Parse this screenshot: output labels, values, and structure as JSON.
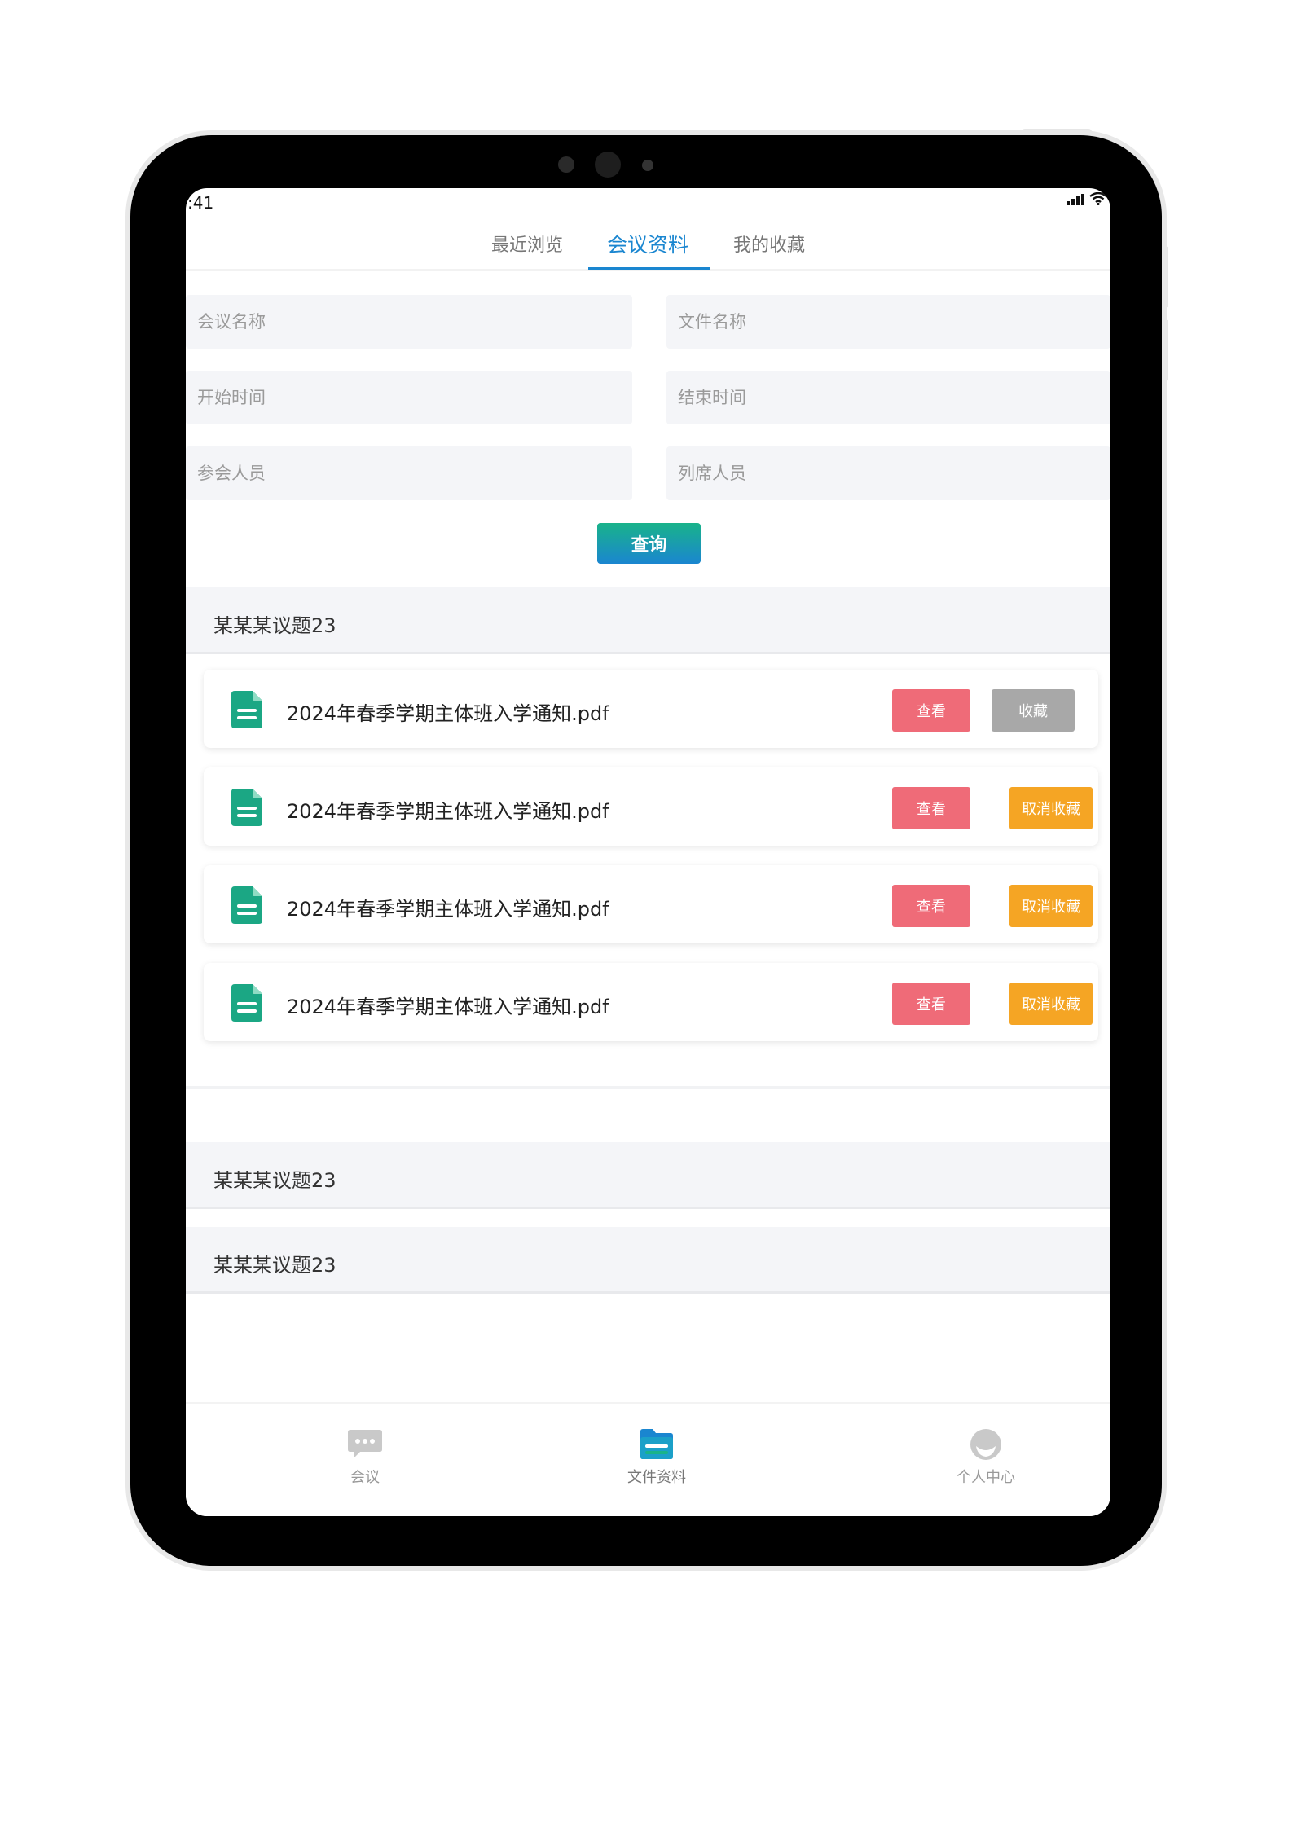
{
  "status": {
    "time": ":41"
  },
  "tabs": [
    {
      "label": "最近浏览"
    },
    {
      "label": "会议资料"
    },
    {
      "label": "我的收藏"
    }
  ],
  "filters": {
    "meeting_name": "会议名称",
    "file_name": "文件名称",
    "start_time": "开始时间",
    "end_time": "结束时间",
    "attendees": "参会人员",
    "observers": "列席人员"
  },
  "query_label": "查询",
  "sections": [
    {
      "title": "某某某议题23",
      "files": [
        {
          "name": "2024年春季学期主体班入学通知.pdf",
          "view": "查看",
          "action": "收藏"
        },
        {
          "name": "2024年春季学期主体班入学通知.pdf",
          "view": "查看",
          "action": "取消收藏"
        },
        {
          "name": "2024年春季学期主体班入学通知.pdf",
          "view": "查看",
          "action": "取消收藏"
        },
        {
          "name": "2024年春季学期主体班入学通知.pdf",
          "view": "查看",
          "action": "取消收藏"
        }
      ]
    },
    {
      "title": "某某某议题23"
    },
    {
      "title": "某某某议题23"
    }
  ],
  "bottom_nav": [
    {
      "label": "会议",
      "icon": "chat-icon"
    },
    {
      "label": "文件资料",
      "icon": "folder-icon"
    },
    {
      "label": "个人中心",
      "icon": "user-icon"
    }
  ],
  "colors": {
    "accent": "#1a86d0",
    "view_button": "#ef6b78",
    "favorite_button": "#a8a8a8",
    "unfavorite_button": "#f5a524",
    "file_icon": "#1ba784"
  }
}
